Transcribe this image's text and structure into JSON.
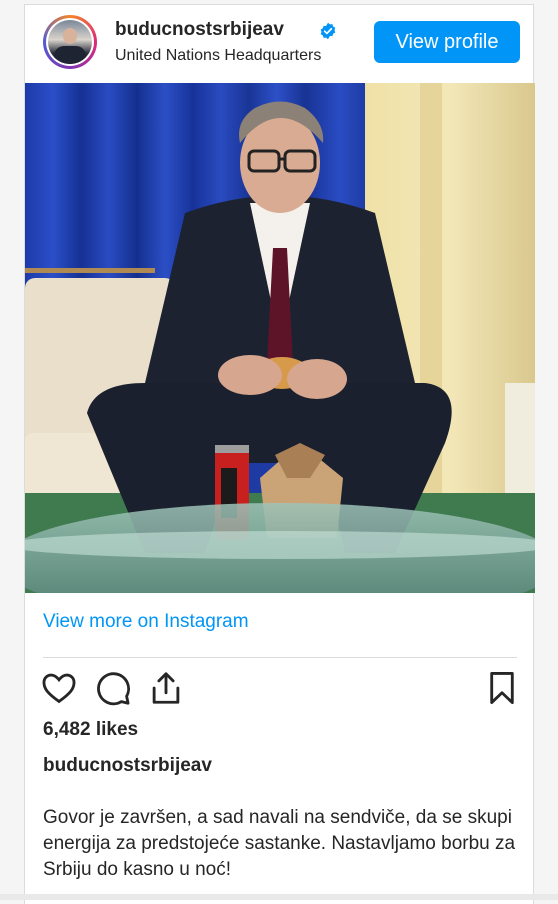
{
  "post": {
    "username": "buducnostsrbijeav",
    "location": "United Nations Headquarters",
    "view_profile_label": "View profile",
    "view_more_label": "View more on Instagram",
    "likes": "6,482 likes",
    "caption_user": "buducnostsrbijeav",
    "caption_text": "Govor je završen, a sad navali na sendviče, da se skupi energija za predstojeće sastanke. Nastavljamo borbu za Srbiju do kasno u noć!"
  },
  "icons": {
    "avatar": "profile-avatar",
    "verified": "verified-badge-icon",
    "like": "heart-icon",
    "comment": "comment-icon",
    "share": "share-icon",
    "save": "bookmark-icon"
  },
  "colors": {
    "accent": "#0095f6",
    "text": "#262626",
    "border": "#dbdbdb"
  }
}
